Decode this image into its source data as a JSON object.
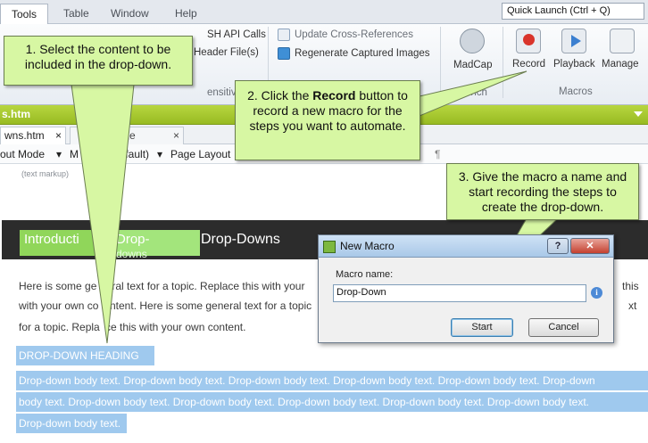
{
  "ribbon": {
    "tabs": [
      "Tools",
      "Table",
      "Window",
      "Help"
    ],
    "quick_launch": "Quick Launch (Ctrl + Q)",
    "items": {
      "api_calls": "SH API Calls",
      "header_files": "Header File(s)",
      "sensitive": "ensitive",
      "update_xrefs": "Update Cross-References",
      "regen_images": "Regenerate Captured Images",
      "madcap": "MadCap",
      "launch": "unch",
      "record": "Record",
      "playback": "Playback",
      "manage": "Manage",
      "macros_group": "Macros"
    }
  },
  "document": {
    "title": "s.htm",
    "tab1": "wns.htm",
    "tab1_close": "×",
    "tab2": "rt Page",
    "tab2_close": "×",
    "toolbar": [
      "out Mode",
      "M",
      "(default)",
      "Page Layout"
    ],
    "markup_note": "(text markup)"
  },
  "content": {
    "header_intro": "Introducti",
    "header_drop": "Drop-",
    "header_drop2": "downs",
    "header_title": "Drop-Downs",
    "para": [
      "Here is some ge",
      "neral text for a topic. Replace this with your",
      "this",
      "with your own co",
      "ntent. Here is some general text for a topic",
      "xt",
      "for a topic. Repla",
      "ce this with your own content."
    ],
    "heading": "DROP-DOWN HEADING",
    "body_lines": [
      "Drop-down body text. Drop-down body text. Drop-down body text. Drop-down body text. Drop-down body text. Drop-down",
      "body text. Drop-down body text. Drop-down body text. Drop-down body text. Drop-down body text. Drop-down body text.",
      "Drop-down body text."
    ]
  },
  "callouts": {
    "step1": "1. Select the content to be included in the drop-down.",
    "step2_pre": "2. Click the ",
    "step2_bold": "Record",
    "step2_post": " button to record a new macro for the steps you want to automate.",
    "step3": "3. Give the macro a name and start recording the steps to create the drop-down."
  },
  "dialog": {
    "title": "New Macro",
    "help_btn": "?",
    "close_btn": "✕",
    "label": "Macro name:",
    "value": "Drop-Down",
    "info": "i",
    "start": "Start",
    "cancel": "Cancel"
  },
  "colors": {
    "callout_fill": "#d7f7a3",
    "title_bar": "#a6c92c",
    "selection": "#9fc9ee"
  }
}
